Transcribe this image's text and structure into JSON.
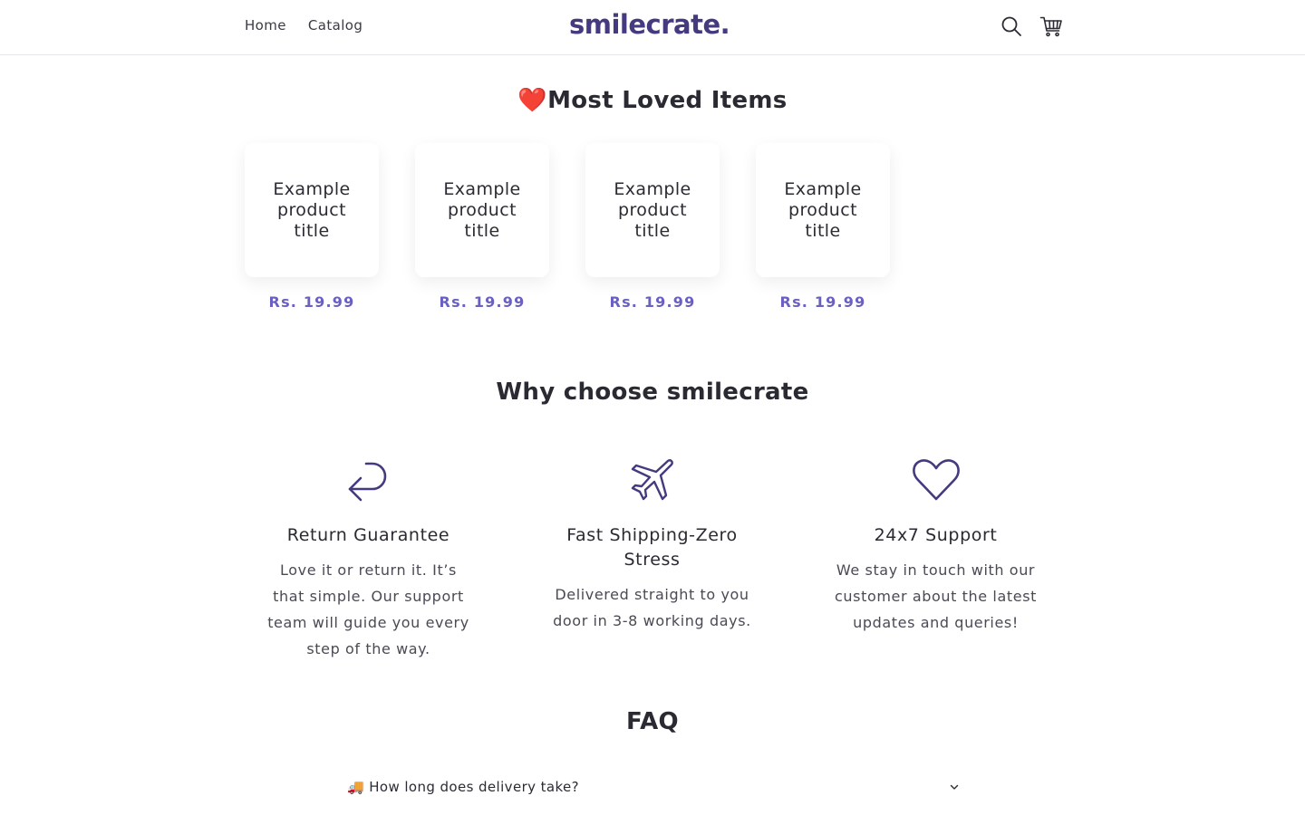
{
  "header": {
    "nav": [
      {
        "label": "Home"
      },
      {
        "label": "Catalog"
      }
    ],
    "logo": "smilecrate.",
    "icons": [
      "search-icon",
      "cart-icon"
    ]
  },
  "most_loved": {
    "heading": "❤️Most Loved Items",
    "products": [
      {
        "title": "Example product title",
        "price": "Rs. 19.99"
      },
      {
        "title": "Example product title",
        "price": "Rs. 19.99"
      },
      {
        "title": "Example product title",
        "price": "Rs. 19.99"
      },
      {
        "title": "Example product title",
        "price": "Rs. 19.99"
      }
    ]
  },
  "why": {
    "heading": "Why choose smilecrate",
    "features": [
      {
        "icon": "return-arrow-icon",
        "title": "Return Guarantee",
        "text": "Love it or return it. It’s that simple. Our support team will guide you every step of the way."
      },
      {
        "icon": "airplane-icon",
        "title": "Fast Shipping-Zero Stress",
        "text": "Delivered straight to you door in 3-8 working days."
      },
      {
        "icon": "heart-icon",
        "title": "24x7 Support",
        "text": "We stay in touch with our customer about the latest updates and queries!"
      }
    ]
  },
  "faq": {
    "heading": "FAQ",
    "items": [
      {
        "question": "🚚 How long does delivery take?"
      }
    ]
  },
  "colors": {
    "brand": "#453a7f",
    "price": "#6a60c2",
    "text": "#2b2b33"
  }
}
